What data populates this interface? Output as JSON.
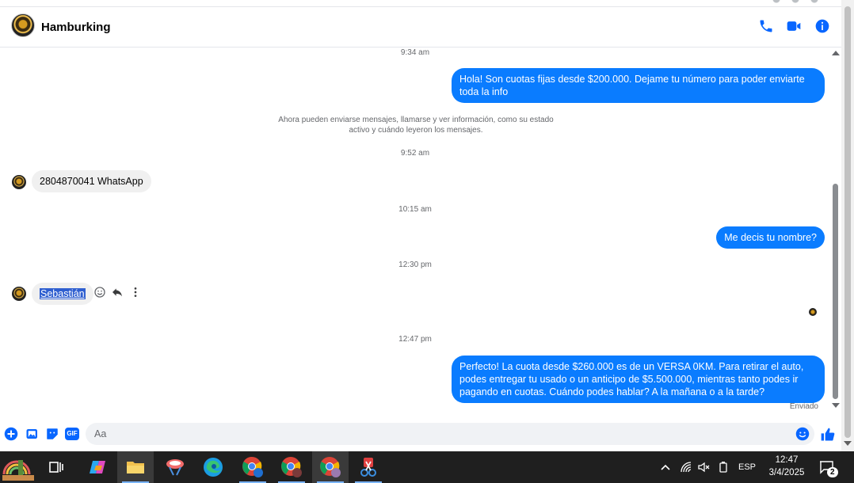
{
  "header": {
    "title": "Hamburking"
  },
  "messages": {
    "ts1": "9:34 am",
    "out1": "Hola! Son cuotas fijas desde $200.000. Dejame tu número para poder enviarte toda la info",
    "system": "Ahora pueden enviarse mensajes, llamarse y ver información, como su estado activo y cuándo leyeron los mensajes.",
    "ts2": "9:52 am",
    "in1": "2804870041 WhatsApp",
    "ts3": "10:15 am",
    "out2": "Me decis tu nombre?",
    "ts4": "12:30 pm",
    "in2": "Sebastián",
    "ts5": "12:47 pm",
    "out3": "Perfecto! La cuota desde $260.000 es de un VERSA 0KM. Para retirar el auto, podes entregar tu usado o un anticipo de $5.500.000, mientras tanto podes ir pagando en cuotas. Cuándo podes hablar? A la mañana o a la tarde?",
    "status": "Enviado"
  },
  "composer": {
    "placeholder": "Aa",
    "gif_label": "GIF"
  },
  "taskbar": {
    "language": "ESP",
    "time": "12:47",
    "date": "3/4/2025",
    "notification_count": "2"
  },
  "colors": {
    "accent": "#0866ff",
    "bubble_out": "#0a7cff",
    "bubble_in": "#f0f0f0",
    "taskbar": "#1f1f1f"
  }
}
